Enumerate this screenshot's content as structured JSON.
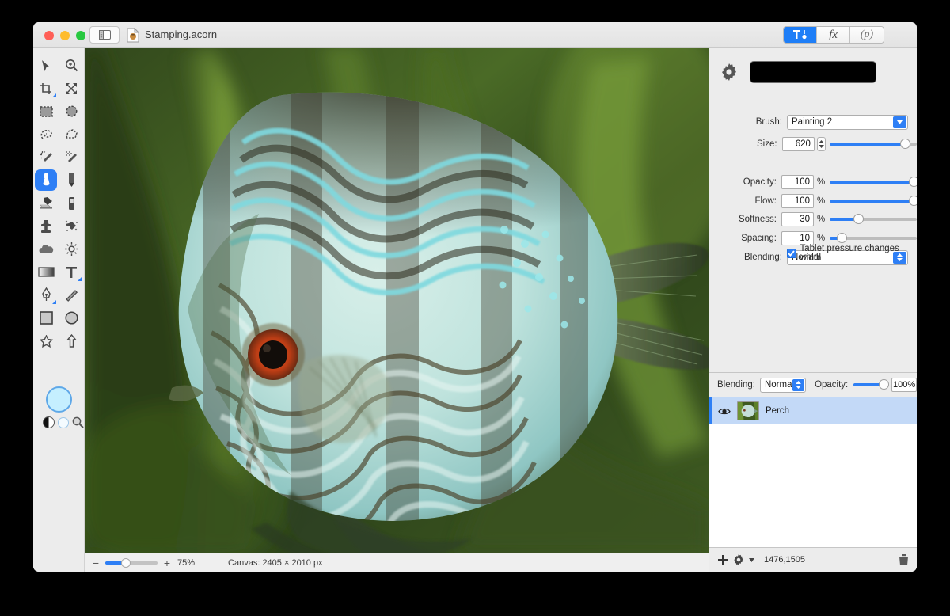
{
  "window": {
    "title": "Stamping.acorn",
    "traffic_lights": [
      "close",
      "minimize",
      "zoom"
    ],
    "sidebar_toggle_icon": "sidebar-toggle-icon",
    "document_icon": "acorn-document-icon"
  },
  "segmented_control": {
    "items": [
      {
        "label": "",
        "icon": "tools-icon",
        "active": true
      },
      {
        "label": "fx",
        "icon": "effects-icon",
        "active": false
      },
      {
        "label": "(p)",
        "icon": "palette-icon",
        "active": false
      }
    ]
  },
  "tools": {
    "rows": [
      [
        {
          "name": "move-tool-icon",
          "selected": false
        },
        {
          "name": "zoom-tool-icon",
          "selected": false
        }
      ],
      [
        {
          "name": "crop-tool-icon",
          "selected": false,
          "badge": true
        },
        {
          "name": "transform-tool-icon",
          "selected": false
        }
      ],
      [
        {
          "name": "rectangle-select-icon",
          "selected": false
        },
        {
          "name": "ellipse-select-icon",
          "selected": false
        }
      ],
      [
        {
          "name": "lasso-select-icon",
          "selected": false
        },
        {
          "name": "polygon-lasso-icon",
          "selected": false
        }
      ],
      [
        {
          "name": "magic-wand-icon",
          "selected": false
        },
        {
          "name": "instant-alpha-icon",
          "selected": false
        }
      ],
      [
        {
          "name": "paint-brush-icon",
          "selected": true
        },
        {
          "name": "pencil-icon",
          "selected": false
        }
      ],
      [
        {
          "name": "eraser-icon",
          "selected": false
        },
        {
          "name": "marker-icon",
          "selected": false
        }
      ],
      [
        {
          "name": "clone-stamp-icon",
          "selected": false
        },
        {
          "name": "smudge-icon",
          "selected": false
        }
      ],
      [
        {
          "name": "blur-icon",
          "selected": false
        },
        {
          "name": "dodge-burn-icon",
          "selected": false
        }
      ],
      [
        {
          "name": "gradient-tool-icon",
          "selected": false
        },
        {
          "name": "text-tool-icon",
          "selected": false,
          "badge": true
        }
      ],
      [
        {
          "name": "bezier-pen-icon",
          "selected": false,
          "badge": true
        },
        {
          "name": "line-tool-icon",
          "selected": false
        }
      ],
      [
        {
          "name": "rectangle-shape-icon",
          "selected": false
        },
        {
          "name": "ellipse-shape-icon",
          "selected": false
        }
      ],
      [
        {
          "name": "star-shape-icon",
          "selected": false
        },
        {
          "name": "arrow-shape-icon",
          "selected": false
        }
      ]
    ],
    "brush_preview_color": "#c5efff",
    "brush_preview_border": "#5fa8e8",
    "swatches": [
      {
        "name": "swap-colors-icon"
      },
      {
        "name": "foreground-color-swatch"
      },
      {
        "name": "loupe-icon"
      }
    ]
  },
  "brush_panel": {
    "gear_icon": "gear-icon",
    "color_well": "#000000",
    "brush_label": "Brush:",
    "brush_value": "Painting 2",
    "size_label": "Size:",
    "size_value": "620",
    "size_slider_pct": 87,
    "opacity_label": "Opacity:",
    "opacity_value": "100",
    "opacity_unit": "%",
    "opacity_slider_pct": 100,
    "flow_label": "Flow:",
    "flow_value": "100",
    "flow_unit": "%",
    "flow_slider_pct": 100,
    "softness_label": "Softness:",
    "softness_value": "30",
    "softness_unit": "%",
    "softness_slider_pct": 30,
    "spacing_label": "Spacing:",
    "spacing_value": "10",
    "spacing_unit": "%",
    "spacing_slider_pct": 10,
    "blending_label": "Blending:",
    "blending_value": "Normal",
    "tablet_checkbox_label": "Tablet pressure changes width",
    "tablet_checkbox_checked": true
  },
  "layers_panel": {
    "blending_label": "Blending:",
    "blending_value": "Normal",
    "opacity_label": "Opacity:",
    "opacity_value": "100%",
    "opacity_slider_pct": 100,
    "layers": [
      {
        "name": "Perch",
        "visible": true,
        "selected": true
      }
    ],
    "footer": {
      "add_icon": "add-layer-icon",
      "actions_icon": "layer-actions-gear-icon",
      "coordinates": "1476,1505",
      "delete_icon": "delete-layer-trash-icon"
    }
  },
  "status_bar": {
    "zoom_out_icon": "zoom-out-icon",
    "zoom_in_icon": "zoom-in-icon",
    "zoom_level": "75%",
    "zoom_slider_pct": 34,
    "canvas_info": "Canvas: 2405 × 2010 px"
  },
  "canvas": {
    "image_description": "discus-fish-photograph",
    "background_color": "#3d5622",
    "fish_body_color": "#bfe4e0",
    "fish_stripe_color": "#3a3320",
    "eye_iris_color": "#c7481c",
    "eye_pupil_color": "#120d0a"
  },
  "colors": {
    "accent": "#2e7ff5",
    "window_chrome": "#ececec",
    "selection": "#c3d9f7"
  }
}
